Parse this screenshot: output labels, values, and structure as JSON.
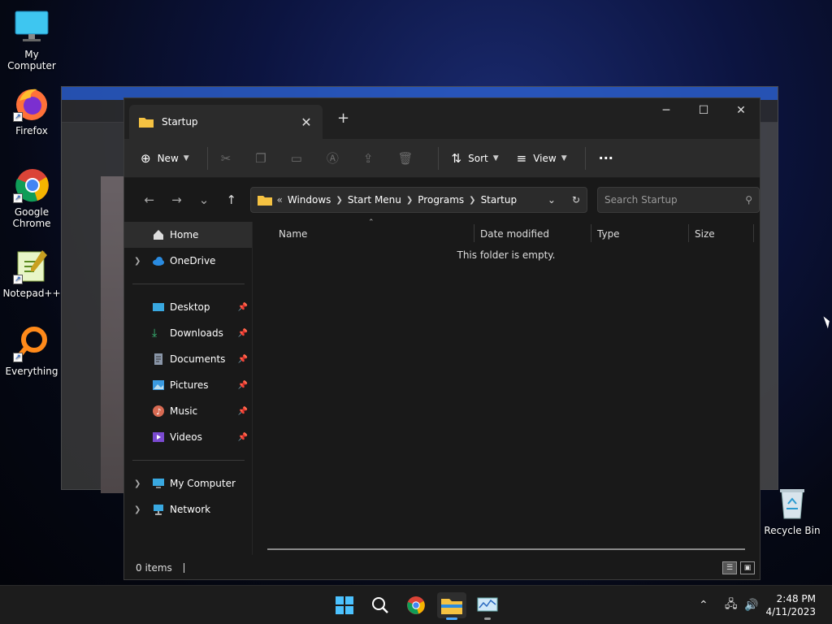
{
  "desktop": {
    "icons": [
      {
        "label": "My Computer"
      },
      {
        "label": "Firefox"
      },
      {
        "label": "Google Chrome"
      },
      {
        "label": "Notepad++"
      },
      {
        "label": "Everything"
      },
      {
        "label": "Recycle Bin"
      }
    ]
  },
  "explorer": {
    "tab_title": "Startup",
    "toolbar": {
      "new_label": "New",
      "sort_label": "Sort",
      "view_label": "View",
      "more_label": "···"
    },
    "address": {
      "overflow": "«",
      "crumbs": [
        "Windows",
        "Start Menu",
        "Programs",
        "Startup"
      ]
    },
    "search_placeholder": "Search Startup",
    "sidebar": {
      "items": [
        {
          "label": "Home"
        },
        {
          "label": "OneDrive"
        },
        {
          "label": "Desktop"
        },
        {
          "label": "Downloads"
        },
        {
          "label": "Documents"
        },
        {
          "label": "Pictures"
        },
        {
          "label": "Music"
        },
        {
          "label": "Videos"
        },
        {
          "label": "My Computer"
        },
        {
          "label": "Network"
        }
      ]
    },
    "columns": [
      "Name",
      "Date modified",
      "Type",
      "Size"
    ],
    "empty_message": "This folder is empty.",
    "status": "0 items"
  },
  "taskbar": {
    "time": "2:48 PM",
    "date": "4/11/2023"
  },
  "colors": {
    "accent": "#4ca8ff",
    "folder": "#f5c242",
    "explorer_bg": "#191919",
    "toolbar_bg": "#2b2b2b"
  }
}
